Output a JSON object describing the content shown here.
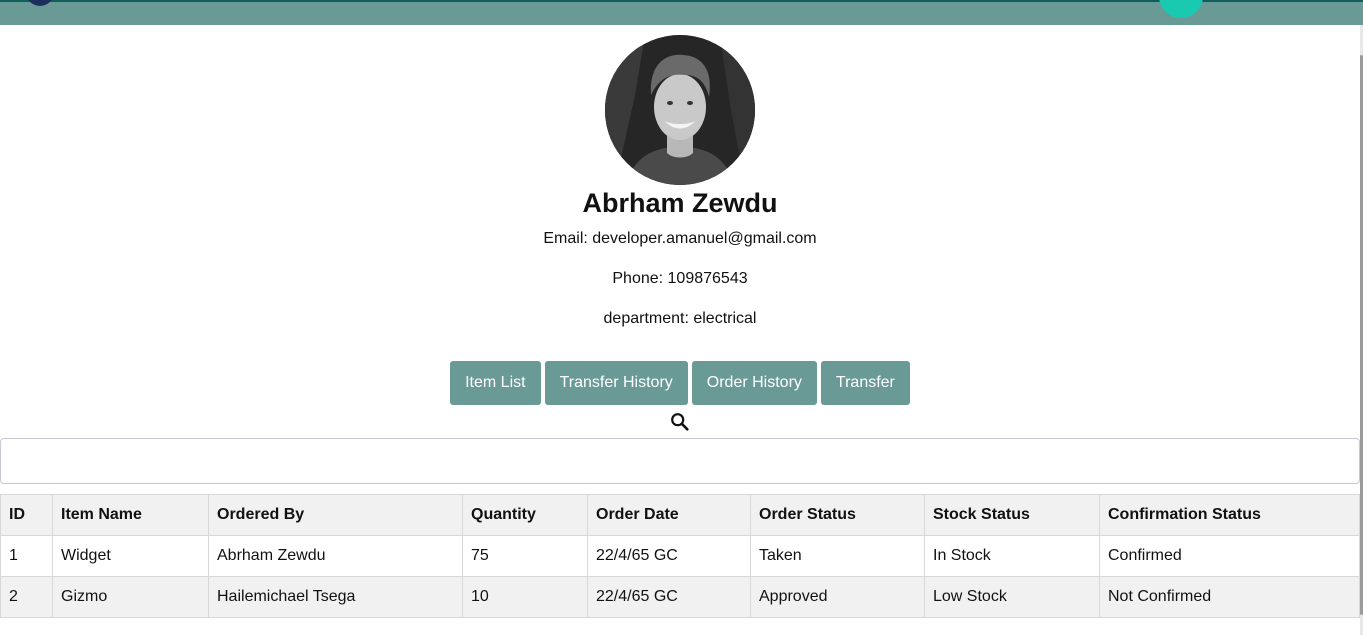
{
  "profile": {
    "name": "Abrham Zewdu",
    "email": "Email: developer.amanuel@gmail.com",
    "phone": "Phone: 109876543",
    "department": "department: electrical"
  },
  "nav_buttons": {
    "item_list": "Item List",
    "transfer_history": "Transfer History",
    "order_history": "Order History",
    "transfer": "Transfer"
  },
  "search": {
    "icon": "search-icon",
    "placeholder": ""
  },
  "table": {
    "headers": [
      "ID",
      "Item Name",
      "Ordered By",
      "Quantity",
      "Order Date",
      "Order Status",
      "Stock Status",
      "Confirmation Status"
    ],
    "rows": [
      [
        "1",
        "Widget",
        "Abrham Zewdu",
        "75",
        "22/4/65 GC",
        "Taken",
        "In Stock",
        "Confirmed"
      ],
      [
        "2",
        "Gizmo",
        "Hailemichael Tsega",
        "10",
        "22/4/65 GC",
        "Approved",
        "Low Stock",
        "Not Confirmed"
      ]
    ]
  },
  "colors": {
    "header_bar": "#6a9a96",
    "button": "#6a9a96",
    "table_header_bg": "#f1f1f1"
  }
}
